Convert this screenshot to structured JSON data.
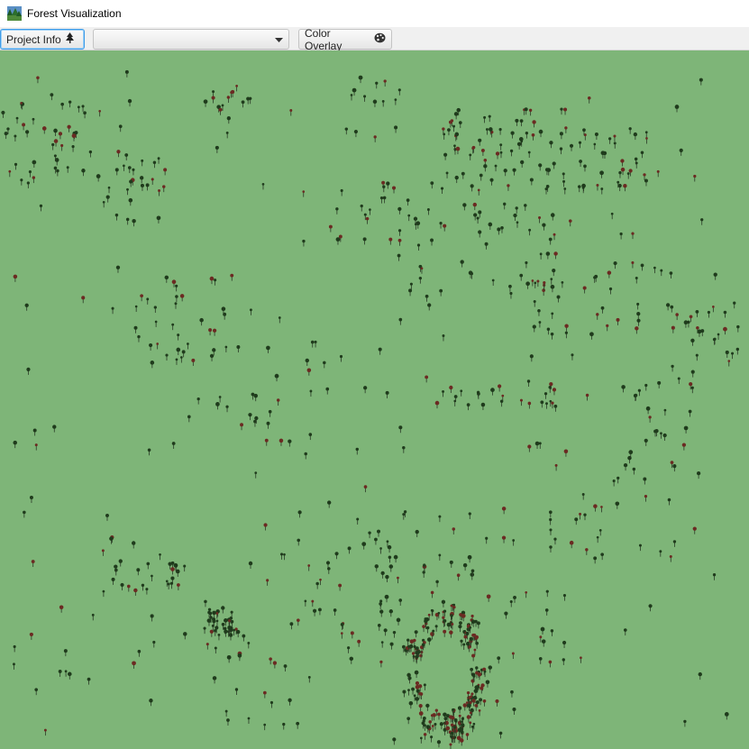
{
  "window": {
    "title": "Forest Visualization",
    "app_icon": "forest-app-icon"
  },
  "toolbar": {
    "project_info_label": "Project Info",
    "project_info_icon": "tree-icon",
    "combo_value": "",
    "combo_icon": "chevron-down-icon",
    "color_overlay_label": "Color Overlay",
    "color_overlay_icon": "palette-icon"
  },
  "viewport": {
    "background": "#7eb578",
    "tree_color_dark": "#1f3b1c",
    "tree_color_red": "#6b2a22"
  }
}
